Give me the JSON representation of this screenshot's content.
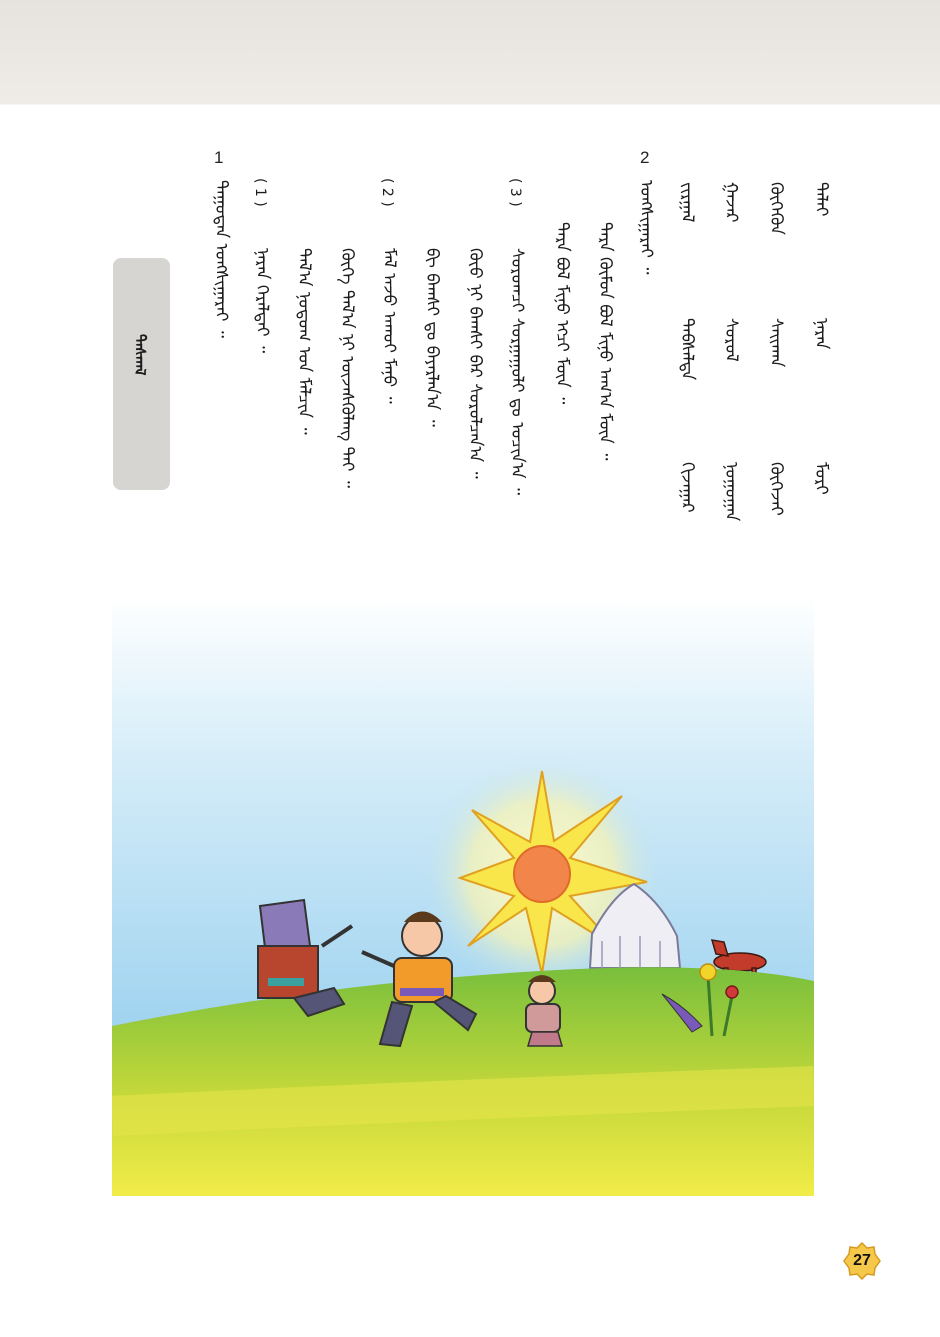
{
  "page_number": "27",
  "section_label": "ᠳᠠᠰᠬᠠᠯ",
  "word_table": {
    "rows": [
      [
        "ᠳᠠᠯᠠᠢ",
        "ᠨᠠᠷᠠᠨ",
        "ᠮᠣᠷᠢ"
      ],
      [
        "ᠬᠥᠬᠡᠬᠦᠨ",
        "ᠰᠠᠢᠬᠠᠨ",
        "ᠬᠥᠭᠡᠵᠡᠢ"
      ],
      [
        "ᠭᠠᠵᠠᠷ",
        "ᠰᠣᠷᠣᠯ",
        "ᠨᠣᠭᠣᠭᠠᠨ"
      ],
      [
        "ᠵᠢᠷᠭᠠᠯ",
        "ᠳᠡᠪᠰᠡᠯᠲᠡ",
        "ᠬᠢᠵᠠᠭᠠᠷ"
      ]
    ]
  },
  "exercise2": {
    "number": "2",
    "instruction": "ᠤᠩᠰᠢᠭᠠᠷᠠᠢ ᠃",
    "sentences": [
      "ᠲᠡᠷᠡ ᠬᠦᠮᠦᠨ ᠪᠣᠯ ᠮᠢᠨᠦ ᠠᠬ᠎ᠠ ᠮᠥᠨ ᠃",
      "ᠲᠡᠷᠡ ᠪᠣᠯ ᠮᠢᠨᠦ ᠡᠭᠴᠢ ᠮᠥᠨ ᠃"
    ]
  },
  "item3": {
    "marker": "( 3 )",
    "text": "ᠰᠤᠷᠤᠭᠴᠢ ᠰᠤᠷᠭᠠᠭᠤᠯᠢ ᠳᠤ ᠣᠴᠢᠨ᠎ᠠ ᠃",
    "lines": [
      "ᠬᠦᠦ ᠨᠢ ᠪᠠᠭᠰᠢ ᠪᠠᠷ ᠰᠤᠷᠤᠯᠴᠠᠨ᠎ᠠ ᠃",
      "ᠪᠢ ᠪᠠᠭᠰᠢ ᠳᠤ ᠪᠠᠶᠠᠷᠯᠠᠨ᠎ᠠ ᠃"
    ]
  },
  "item2": {
    "marker": "( 2 )",
    "text": "ᠮᠠᠯ ᠠᠵᠤ ᠠᠬᠤᠢ ᠮᠠᠨᠤ ᠃",
    "lines": [
      "ᠬᠥᠭᠡ ᠲᠠᠯ᠎ᠠ ᠨᠢ ᠦᠵᠡᠰᠭᠦᠯᠡᠩ ᠲᠠᠢ ᠃",
      "ᠲᠠᠯ᠎ᠠ ᠨᠤᠲᠤᠭ ᠤᠨ ᠮᠠᠯᠴᠢᠨ ᠃"
    ]
  },
  "item1": {
    "marker": "( 1 )",
    "text": "ᠨᠠᠷᠠᠨ ᠭᠡᠷᠡᠯᠲᠡᠢ ᠃"
  },
  "exercise1": {
    "number": "1",
    "instruction": "ᠳᠠᠭᠤᠳᠠᠨ ᠤᠩᠰᠢᠭᠠᠷᠠᠢ ᠃"
  },
  "colors": {
    "sky_top": "#ffffff",
    "sky": "#7ec3ea",
    "grass": "#79bf3c",
    "sun": "#f2864a",
    "sun_rays": "#f8e64a",
    "badge": "#f5c84a"
  }
}
